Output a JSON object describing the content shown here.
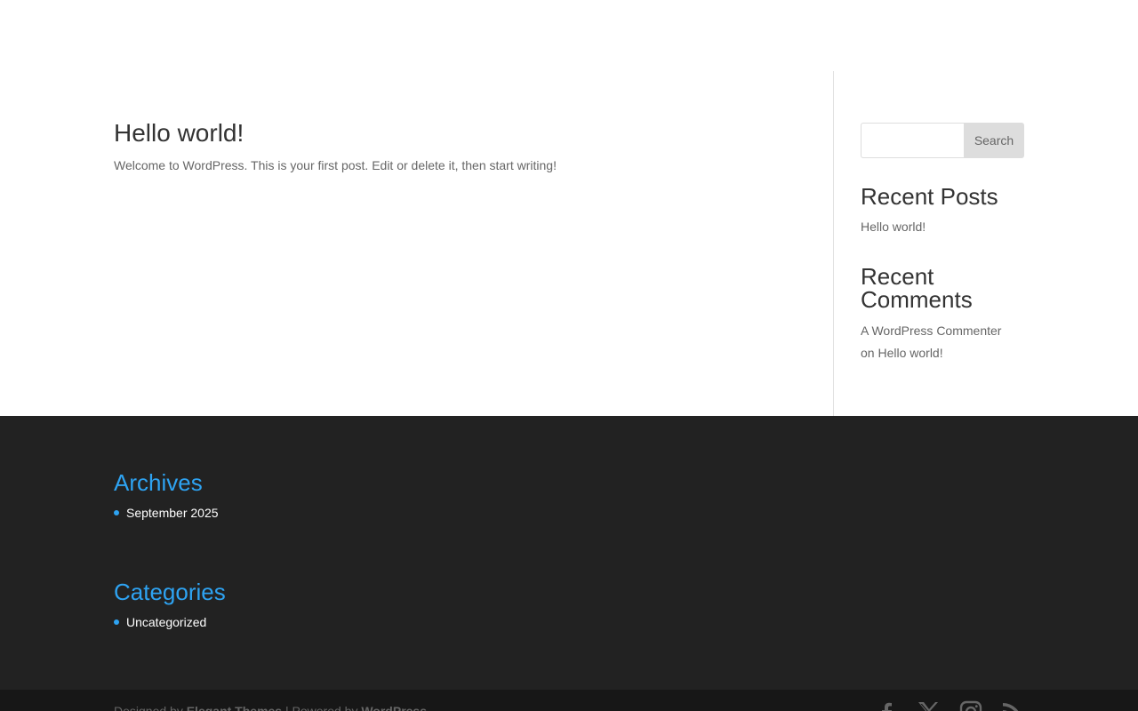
{
  "post": {
    "title": "Hello world!",
    "excerpt": "Welcome to WordPress. This is your first post. Edit or delete it, then start writing!"
  },
  "sidebar": {
    "search_placeholder": "",
    "search_button": "Search",
    "recent_posts_title": "Recent Posts",
    "recent_posts": [
      "Hello world!"
    ],
    "recent_comments_title": "Recent Comments",
    "recent_comment": {
      "author": "A WordPress Commenter",
      "on": "on",
      "post": "Hello world!"
    }
  },
  "footer": {
    "archives_title": "Archives",
    "archives": [
      "September 2025"
    ],
    "categories_title": "Categories",
    "categories": [
      "Uncategorized"
    ]
  },
  "bottom_bar": {
    "designed_by": "Designed by",
    "theme_author": "Elegant Themes",
    "separator": "| Powered by",
    "platform": "WordPress",
    "social_icons": [
      "facebook-icon",
      "x-icon",
      "instagram-icon",
      "rss-icon"
    ]
  },
  "colors": {
    "accent": "#2ea3f2",
    "footer_bg": "#222222",
    "bottom_bar_bg": "#171717",
    "heading": "#333333",
    "body_text": "#666666"
  }
}
